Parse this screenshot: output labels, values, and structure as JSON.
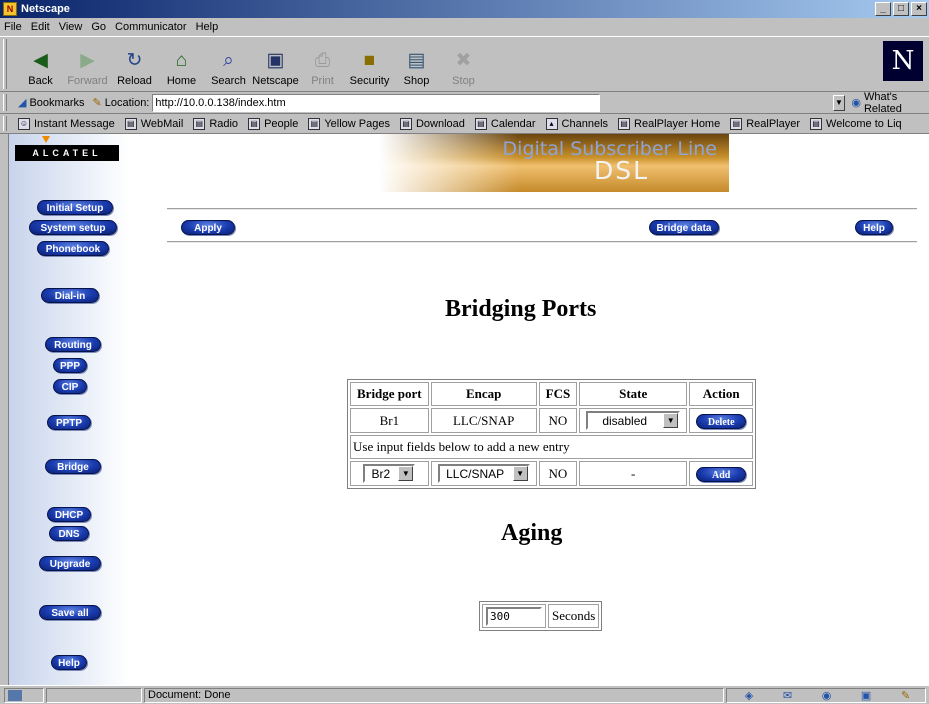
{
  "window": {
    "title": "Netscape"
  },
  "menu": [
    "File",
    "Edit",
    "View",
    "Go",
    "Communicator",
    "Help"
  ],
  "toolbar": [
    {
      "label": "Back",
      "icon": "back-icon",
      "glyph": "◀",
      "enabled": true
    },
    {
      "label": "Forward",
      "icon": "forward-icon",
      "glyph": "▶",
      "enabled": false
    },
    {
      "label": "Reload",
      "icon": "reload-icon",
      "glyph": "↻",
      "enabled": true
    },
    {
      "label": "Home",
      "icon": "home-icon",
      "glyph": "⌂",
      "enabled": true
    },
    {
      "label": "Search",
      "icon": "search-icon",
      "glyph": "⌕",
      "enabled": true
    },
    {
      "label": "Netscape",
      "icon": "netscape-icon",
      "glyph": "▣",
      "enabled": true
    },
    {
      "label": "Print",
      "icon": "print-icon",
      "glyph": "⎙",
      "enabled": false
    },
    {
      "label": "Security",
      "icon": "lock-icon",
      "glyph": "🔓",
      "enabled": true
    },
    {
      "label": "Shop",
      "icon": "shop-icon",
      "glyph": "▤",
      "enabled": true
    },
    {
      "label": "Stop",
      "icon": "stop-icon",
      "glyph": "✖",
      "enabled": false
    }
  ],
  "location": {
    "bookmarks_label": "Bookmarks",
    "label": "Location:",
    "url": "http://10.0.0.138/index.htm",
    "related": "What's Related"
  },
  "personal_toolbar": [
    "Instant Message",
    "WebMail",
    "Radio",
    "People",
    "Yellow Pages",
    "Download",
    "Calendar",
    "Channels",
    "RealPlayer Home",
    "RealPlayer",
    "Welcome to Liq"
  ],
  "brand": {
    "logo": "ALCATEL",
    "banner_line1": "Digital Subscriber Line",
    "banner_line2": "DSL"
  },
  "sidebar": [
    "Initial Setup",
    "System setup",
    "Phonebook",
    "Dial-in",
    "Routing",
    "PPP",
    "CIP",
    "PPTP",
    "Bridge",
    "DHCP",
    "DNS",
    "Upgrade",
    "Save all",
    "Help"
  ],
  "actions": {
    "apply": "Apply",
    "bridge_data": "Bridge data",
    "help": "Help"
  },
  "page": {
    "title": "Bridging Ports",
    "aging_title": "Aging"
  },
  "bridge_table": {
    "headers": [
      "Bridge port",
      "Encap",
      "FCS",
      "State",
      "Action"
    ],
    "rows": [
      {
        "port": "Br1",
        "encap": "LLC/SNAP",
        "fcs": "NO",
        "state": "disabled",
        "action": "Delete"
      }
    ],
    "add_note": "Use input fields below to add a new entry",
    "new_entry": {
      "port": "Br2",
      "encap": "LLC/SNAP",
      "fcs": "NO",
      "state": "-",
      "action": "Add"
    }
  },
  "aging": {
    "value": "300",
    "unit": "Seconds"
  },
  "status": {
    "text": "Document: Done"
  }
}
